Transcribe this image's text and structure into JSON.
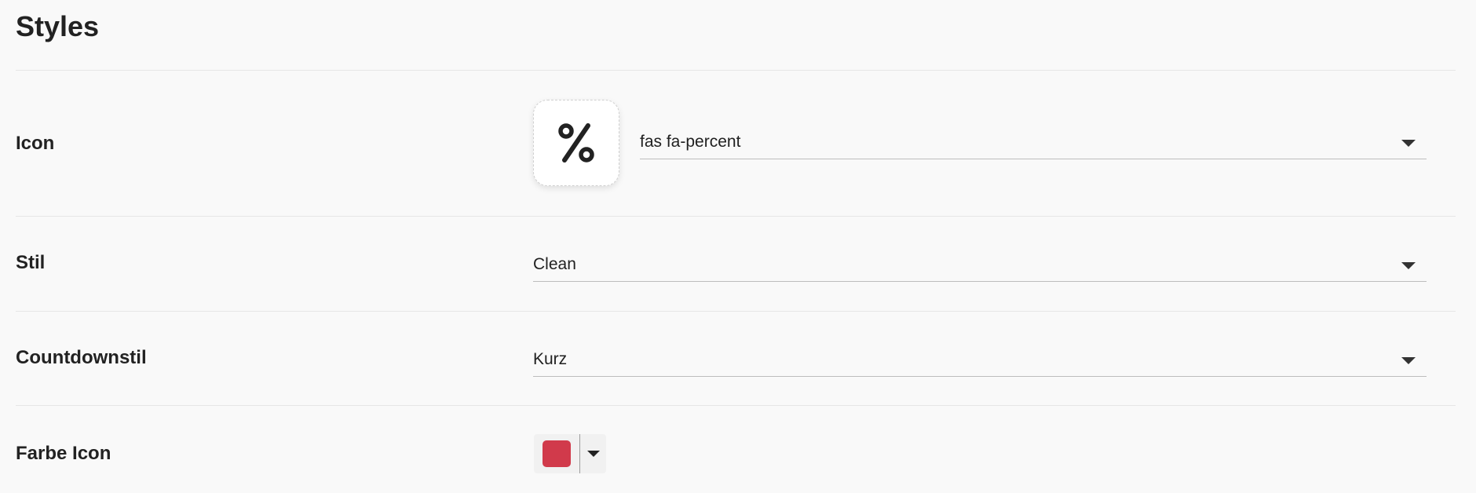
{
  "section": {
    "title": "Styles"
  },
  "rows": {
    "icon": {
      "label": "Icon",
      "value": "fas fa-percent",
      "preview_icon": "percent-icon"
    },
    "stil": {
      "label": "Stil",
      "value": "Clean"
    },
    "countdown": {
      "label": "Countdownstil",
      "value": "Kurz"
    },
    "farbe": {
      "label": "Farbe Icon",
      "color": "#d13a4b"
    }
  },
  "colors": {
    "background": "#f9f9f9",
    "text": "#212121",
    "divider": "#e6e6e6",
    "underline": "#bdbdbd"
  }
}
